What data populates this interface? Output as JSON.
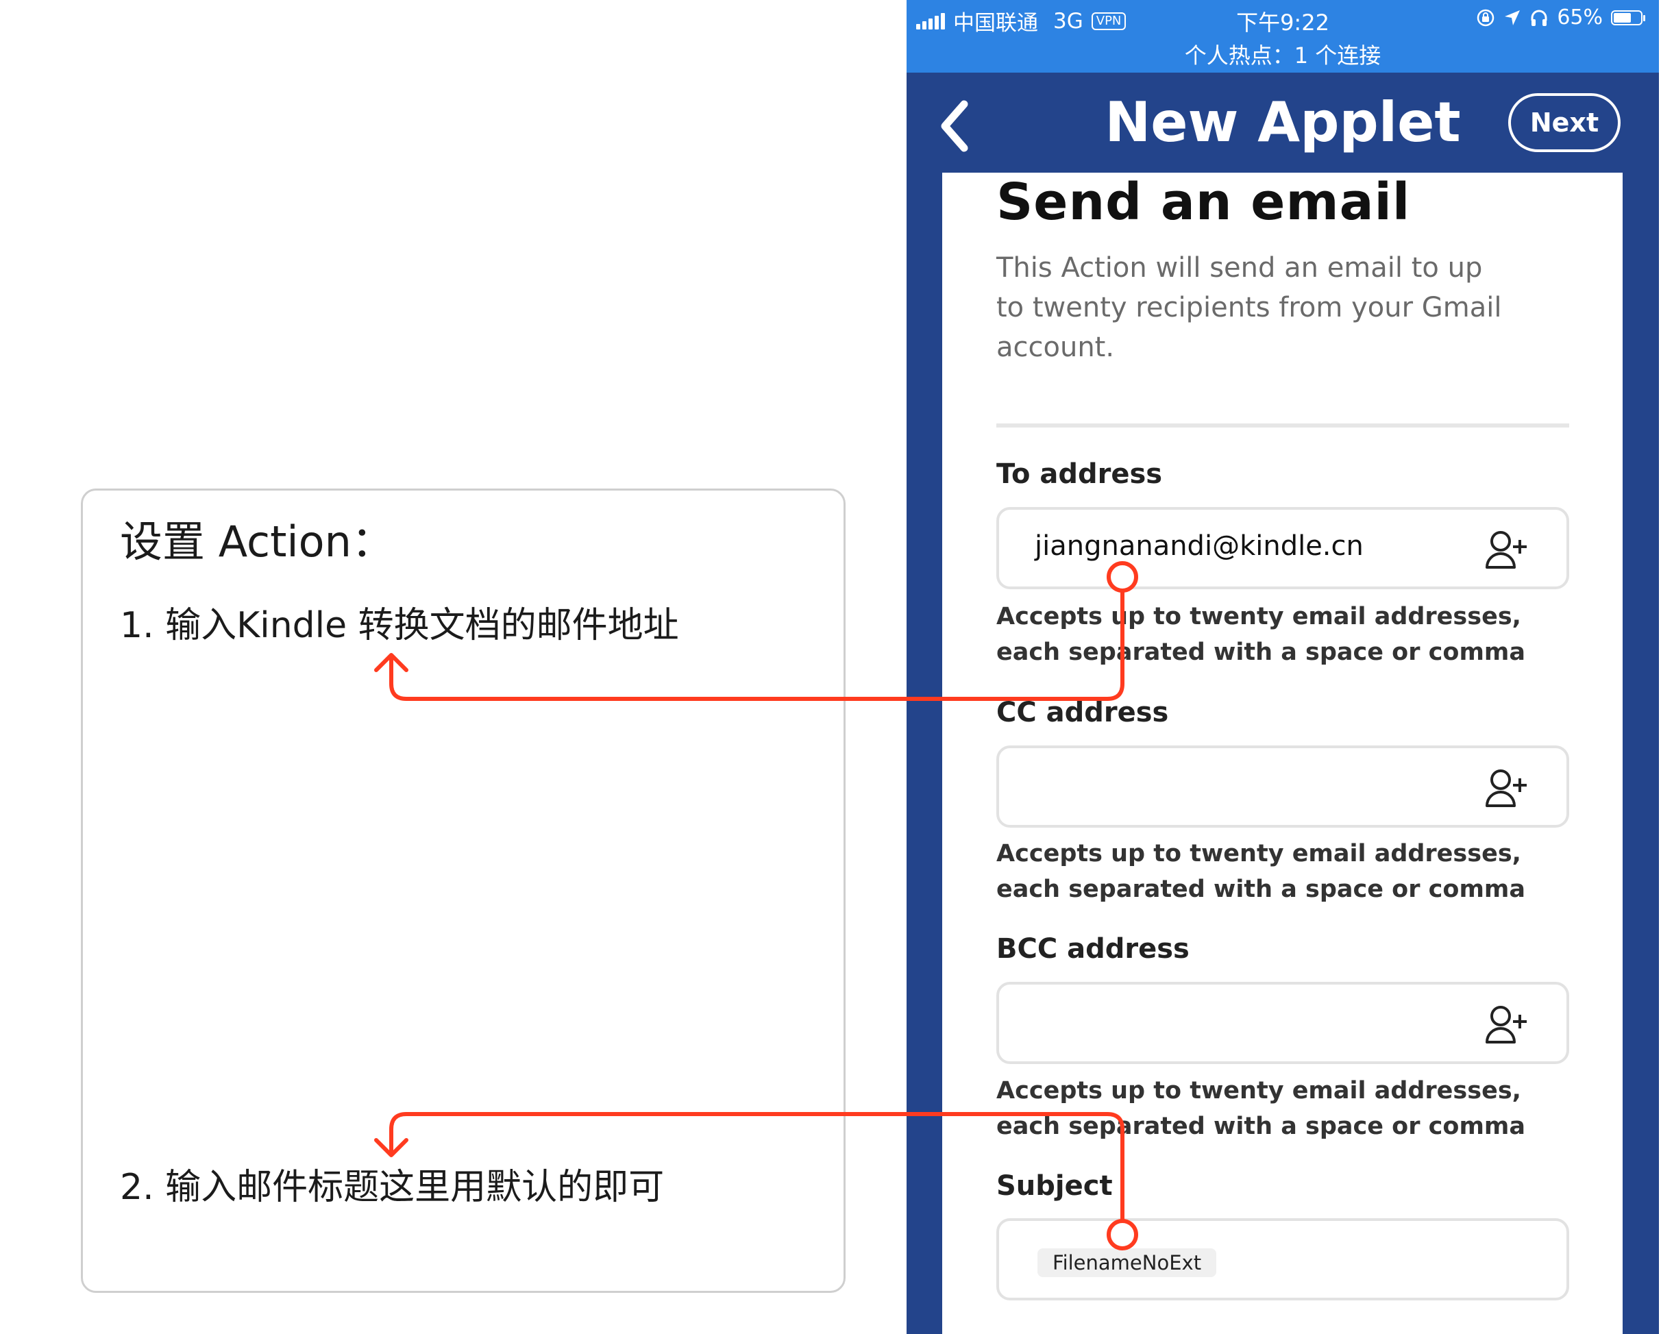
{
  "annotation": {
    "title": "设置 Action：",
    "step1": "1. 输入Kindle 转换文档的邮件地址",
    "step2": "2. 输入邮件标题这里用默认的即可",
    "arrow_color": "#ff3b1f"
  },
  "status_bar": {
    "carrier": "中国联通",
    "network": "3G",
    "vpn": "VPN",
    "time": "下午9:22",
    "battery": "65%",
    "battery_level": 0.65,
    "hotspot": "个人热点：1 个连接",
    "icons": [
      "lock-rotation-icon",
      "location-arrow-icon",
      "headphones-icon"
    ]
  },
  "nav": {
    "title": "New Applet",
    "next_label": "Next",
    "back_icon": "chevron-left-icon"
  },
  "action": {
    "title": "Send an email",
    "description": "This Action will send an email to up to twenty recipients from your Gmail account."
  },
  "fields": {
    "to": {
      "label": "To address",
      "value": "jiangnanandi@kindle.cn",
      "help": "Accepts up to twenty email addresses, each separated with a space or comma",
      "icon": "add-contact-icon"
    },
    "cc": {
      "label": "CC address",
      "value": "",
      "help": "Accepts up to twenty email addresses, each separated with a space or comma",
      "icon": "add-contact-icon"
    },
    "bcc": {
      "label": "BCC address",
      "value": "",
      "help": "Accepts up to twenty email addresses, each separated with a space or comma",
      "icon": "add-contact-icon"
    },
    "subject": {
      "label": "Subject",
      "ingredient": "FilenameNoExt"
    }
  },
  "colors": {
    "status_bar": "#2d83e3",
    "nav_bar": "#23448b",
    "annotation_arrow": "#ff3b1f",
    "help_text": "#333333",
    "description_text": "#6a6a6a"
  }
}
